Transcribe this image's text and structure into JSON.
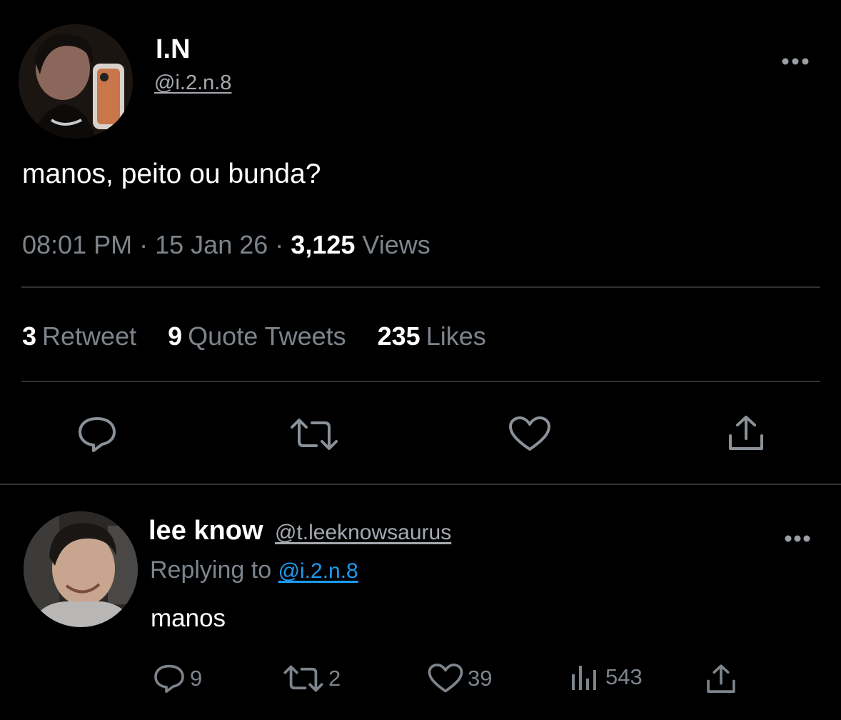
{
  "main_tweet": {
    "author_name": "I.N",
    "author_handle": "@i.2.n.8",
    "more_icon": "ellipsis-icon",
    "text": "manos, peito ou bunda?",
    "time": "08:01 PM",
    "date": "15 Jan 26",
    "separator": "·",
    "views_count": "3,125",
    "views_label": "Views",
    "stats": {
      "retweets_count": "3",
      "retweets_label": "Retweet",
      "quotes_count": "9",
      "quotes_label": "Quote Tweets",
      "likes_count": "235",
      "likes_label": "Likes"
    },
    "actions": [
      "reply-icon",
      "retweet-icon",
      "heart-icon",
      "share-icon"
    ]
  },
  "reply_tweet": {
    "author_name": "lee know",
    "author_handle": "@t.leeknowsaurus",
    "replying_prefix": "Replying to",
    "replying_to": "@i.2.n.8",
    "text": "manos",
    "reply_count": "9",
    "retweet_count": "2",
    "like_count": "39",
    "views_count": "543"
  },
  "colors": {
    "background": "#000000",
    "text_primary": "#ffffff",
    "text_secondary": "#7d848b",
    "divider": "#2f3336",
    "link": "#1d9bf0"
  }
}
